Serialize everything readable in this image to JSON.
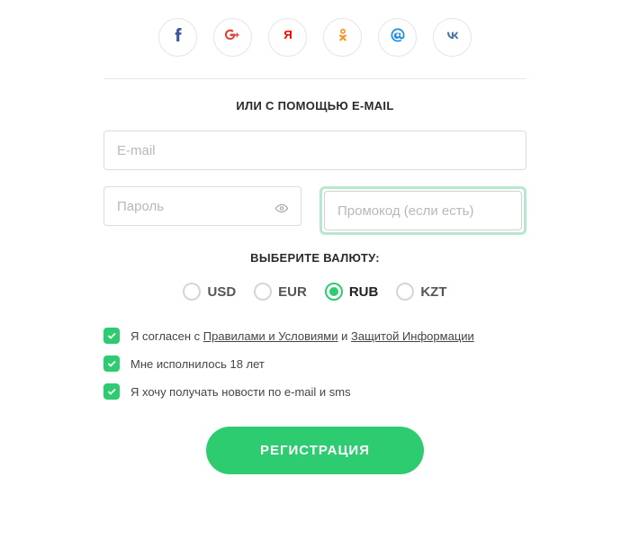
{
  "social": [
    {
      "name": "facebook",
      "color": "#3b5998"
    },
    {
      "name": "google",
      "color": "#db4437"
    },
    {
      "name": "yandex",
      "color": "#ff0000"
    },
    {
      "name": "odnoklassniki",
      "color": "#f7931e"
    },
    {
      "name": "mailru",
      "color": "#168de2"
    },
    {
      "name": "vk",
      "color": "#4c75a3"
    }
  ],
  "section_email_title": "ИЛИ С ПОМОЩЬЮ E-MAIL",
  "inputs": {
    "email_placeholder": "E-mail",
    "password_placeholder": "Пароль",
    "promo_placeholder": "Промокод (если есть)"
  },
  "currency": {
    "title": "ВЫБЕРИТЕ ВАЛЮТУ:",
    "options": [
      "USD",
      "EUR",
      "RUB",
      "KZT"
    ],
    "selected": "RUB"
  },
  "agreements": {
    "terms_prefix": "Я согласен с ",
    "terms_link1": "Правилами и Условиями",
    "terms_mid": " и ",
    "terms_link2": "Защитой Информации",
    "age": "Мне исполнилось 18 лет",
    "news": "Я хочу получать новости по e-mail и sms"
  },
  "submit_label": "РЕГИСТРАЦИЯ"
}
